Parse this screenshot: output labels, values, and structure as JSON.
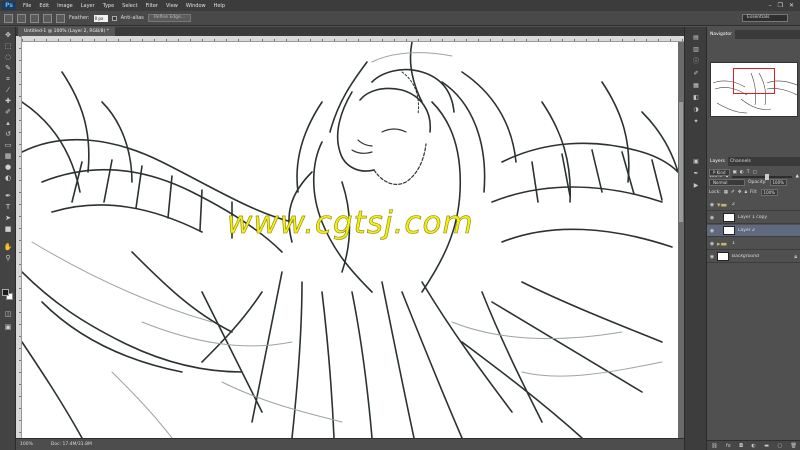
{
  "app": {
    "logo": "Ps"
  },
  "menu": [
    "File",
    "Edit",
    "Image",
    "Layer",
    "Type",
    "Select",
    "Filter",
    "View",
    "Window",
    "Help"
  ],
  "window_controls": [
    "–",
    "❐",
    "✕"
  ],
  "options_bar": {
    "feather_label": "Feather:",
    "feather_value": "0 px",
    "antialias_label": "Anti-alias",
    "refine_edge_label": "Refine Edge...",
    "workspace": "Essentials"
  },
  "document": {
    "tab_title": "Untitled-1 @ 100% (Layer 2, RGB/8) *",
    "zoom": "100%",
    "doc_size": "Doc: 17.4M/31.8M"
  },
  "watermark": "www.cgtsj.com",
  "navigator": {
    "tab": "Navigator",
    "zoom": "100%",
    "zoom_fraction": 0.55
  },
  "layers_panel": {
    "tabs": [
      "Layers",
      "Channels"
    ],
    "filter": "P Kind",
    "blend_mode": "Normal",
    "opacity_label": "Opacity:",
    "opacity": "100%",
    "lock_label": "Lock:",
    "fill_label": "Fill:",
    "fill": "100%",
    "layers": [
      {
        "name": "2",
        "type": "group"
      },
      {
        "name": "Layer 1 copy",
        "type": "layer"
      },
      {
        "name": "Layer 2",
        "type": "layer",
        "selected": true
      },
      {
        "name": "1",
        "type": "group"
      },
      {
        "name": "Background",
        "type": "background"
      }
    ]
  },
  "icons": {
    "tools": [
      "move-icon",
      "marquee-icon",
      "lasso-icon",
      "quick-select-icon",
      "crop-icon",
      "eyedropper-icon",
      "healing-icon",
      "brush-icon",
      "stamp-icon",
      "history-brush-icon",
      "eraser-icon",
      "gradient-icon",
      "blur-icon",
      "dodge-icon",
      "pen-icon",
      "type-icon",
      "path-select-icon",
      "shape-icon",
      "hand-icon",
      "zoom-icon"
    ]
  },
  "colors": {
    "foreground": "#1d1d1d",
    "background": "#ffffff",
    "watermark": "#f3ee1a",
    "navigator_box": "#e01e1e"
  }
}
